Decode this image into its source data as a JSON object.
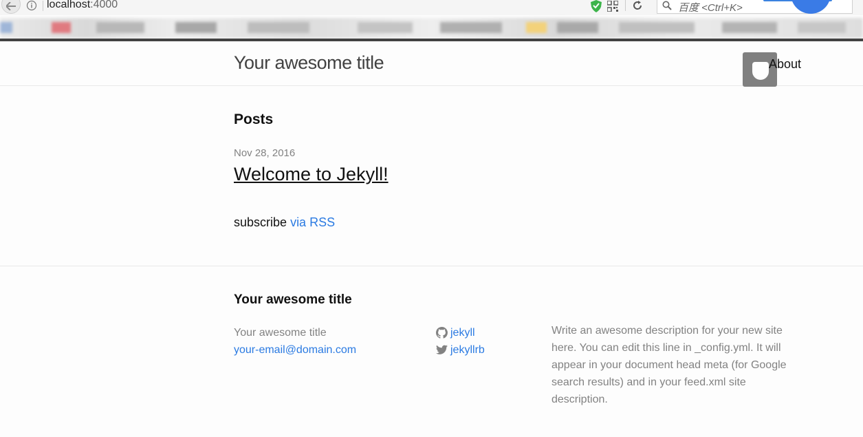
{
  "browser": {
    "url_host": "localhost",
    "url_port": ":4000",
    "search_placeholder": "百度 <Ctrl+K>"
  },
  "header": {
    "site_title": "Your awesome title",
    "nav_about": "About"
  },
  "main": {
    "posts_heading": "Posts",
    "posts": [
      {
        "date": "Nov 28, 2016",
        "title": "Welcome to Jekyll!"
      }
    ],
    "subscribe_text": "subscribe",
    "rss_link": "via RSS"
  },
  "footer": {
    "heading": "Your awesome title",
    "site_name": "Your awesome title",
    "email": "your-email@domain.com",
    "github_user": "jekyll",
    "twitter_user": "jekyllrb",
    "description": "Write an awesome description for your new site here. You can edit this line in _config.yml. It will appear in your document head meta (for Google search results) and in your feed.xml site description."
  },
  "colors": {
    "link": "#2a7ae2",
    "meta_gray": "#828282",
    "title_gray": "#424242",
    "chrome_dark": "#424242"
  },
  "icons": [
    "back-arrow-icon",
    "info-icon",
    "shield-icon",
    "qr-code-icon",
    "reload-icon",
    "search-icon",
    "github-icon",
    "twitter-icon"
  ]
}
